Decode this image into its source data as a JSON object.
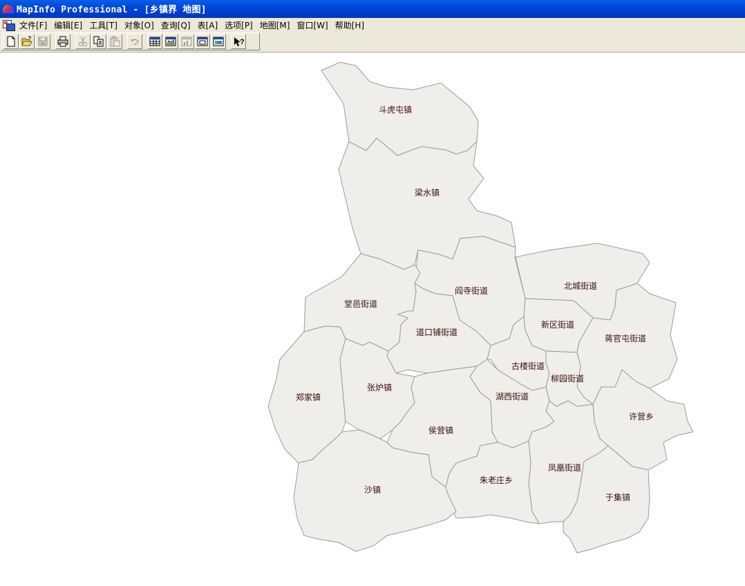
{
  "window": {
    "title": "MapInfo Professional - [乡镇界 地图]"
  },
  "menu": [
    {
      "label": "文件[F]"
    },
    {
      "label": "编辑[E]"
    },
    {
      "label": "工具[T]"
    },
    {
      "label": "对象[O]"
    },
    {
      "label": "查询[Q]"
    },
    {
      "label": "表[A]"
    },
    {
      "label": "选项[P]"
    },
    {
      "label": "地图[M]"
    },
    {
      "label": "窗口[W]"
    },
    {
      "label": "帮助[H]"
    }
  ],
  "toolbar": {
    "buttons": [
      {
        "icon": "new-icon",
        "enabled": true
      },
      {
        "icon": "open-icon",
        "enabled": true
      },
      {
        "icon": "save-icon",
        "enabled": false
      },
      {
        "icon": "print-icon",
        "enabled": true
      },
      {
        "icon": "cut-icon",
        "enabled": false
      },
      {
        "icon": "copy-icon",
        "enabled": true
      },
      {
        "icon": "paste-icon",
        "enabled": false
      },
      {
        "icon": "undo-icon",
        "enabled": false
      },
      {
        "icon": "new-browser-icon",
        "enabled": true
      },
      {
        "icon": "new-mapper-icon",
        "enabled": true
      },
      {
        "icon": "new-grapher-icon",
        "enabled": false
      },
      {
        "icon": "new-layout-icon",
        "enabled": true
      },
      {
        "icon": "new-redistrict-icon",
        "enabled": true
      },
      {
        "icon": "help-icon",
        "enabled": true
      }
    ]
  },
  "map": {
    "fill_color": "#f0eeea",
    "border_color": "#9a9a9a",
    "label_color": "#3a0c0c",
    "labels": {
      "douhutun": "斗虎屯镇",
      "liangshui": "梁水镇",
      "tangyi": "堂邑街道",
      "yansi": "阎寺街道",
      "beicheng": "北城街道",
      "daokoupu": "道口铺街道",
      "xinqu": "新区街道",
      "jiangguantun": "蒋官屯街道",
      "zhengjia": "郑家镇",
      "zhanglu": "张炉镇",
      "gulou": "古楼街道",
      "liuyuan": "柳园街道",
      "huxi": "湖西街道",
      "xuying": "许营乡",
      "houying": "侯营镇",
      "fenghuang": "凤凰街道",
      "zhulaozhuang": "朱老庄乡",
      "sha": "沙镇",
      "yuji": "于集镇"
    }
  }
}
